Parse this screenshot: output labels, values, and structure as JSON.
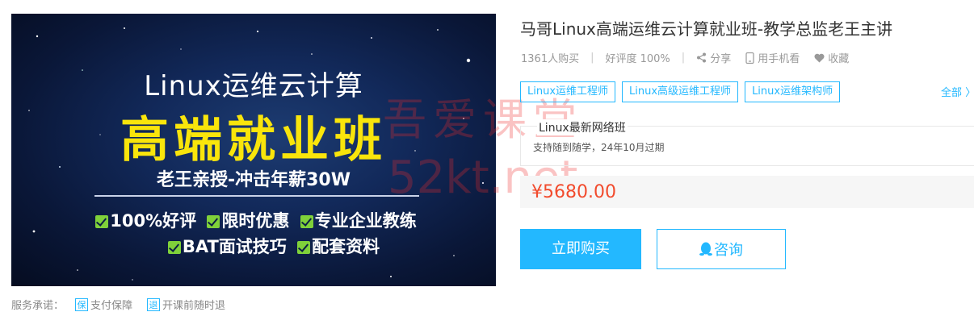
{
  "banner": {
    "line1": "Linux运维云计算",
    "headline": "高端就业班",
    "subline": "老王亲授-冲击年薪30W",
    "features_row1": [
      "100%好评",
      "限时优惠",
      "专业企业教练"
    ],
    "features_row2": [
      "BAT面试技巧",
      "配套资料"
    ]
  },
  "course": {
    "title": "马哥Linux高端运维云计算就业班-教学总监老王主讲",
    "buyers": "1361人购买",
    "rating": "好评度 100%",
    "share_label": "分享",
    "mobile_label": "用手机看",
    "favorite_label": "收藏"
  },
  "tags": [
    "Linux运维工程师",
    "Linux高级运维工程师",
    "Linux运维架构师"
  ],
  "all_link": "全部",
  "plan": {
    "title": "Linux最新网络班",
    "description": "支持随到随学，24年10月过期"
  },
  "price": "¥5680.00",
  "buttons": {
    "buy": "立即购买",
    "consult": "咨询"
  },
  "watermark": {
    "line1": "吾爱课堂",
    "line2": "52kt.net"
  },
  "service": {
    "label": "服务承诺：",
    "items": [
      "支付保障",
      "开课前随时退"
    ]
  },
  "colors": {
    "accent": "#23b8ff",
    "price": "#f24b2d",
    "banner_headline": "#f9e50b",
    "check": "#7fd13a"
  }
}
